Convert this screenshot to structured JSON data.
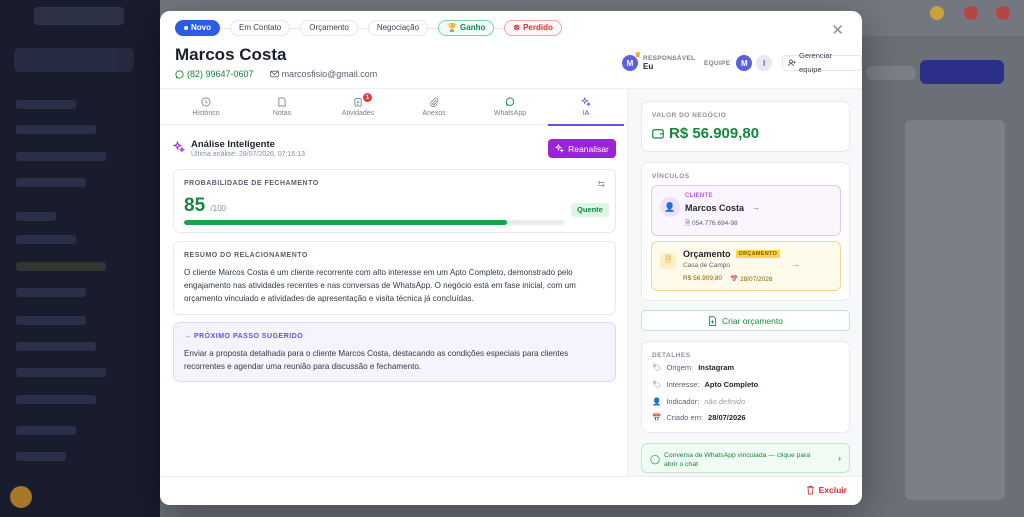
{
  "stages": [
    {
      "label": "Novo",
      "state": "active"
    },
    {
      "label": "Em Contato",
      "state": "default"
    },
    {
      "label": "Orçamento",
      "state": "default"
    },
    {
      "label": "Negociação",
      "state": "default"
    },
    {
      "label": "Ganho",
      "state": "won"
    },
    {
      "label": "Perdido",
      "state": "lost"
    }
  ],
  "lead": {
    "name": "Marcos Costa",
    "phone": "(82) 99647-0607",
    "email": "marcosfisio@gmail.com"
  },
  "responsible": {
    "label": "RESPONSÁVEL",
    "value": "Eu",
    "avatar": "M"
  },
  "team": {
    "label": "EQUIPE",
    "members": [
      "M",
      "I"
    ],
    "manage_label": "Gerenciar equipe"
  },
  "tabs": [
    {
      "label": "Histórico",
      "icon": "history-icon"
    },
    {
      "label": "Notas",
      "icon": "note-icon"
    },
    {
      "label": "Atividades",
      "icon": "clipboard-icon",
      "badge": "1"
    },
    {
      "label": "Anexos",
      "icon": "paperclip-icon"
    },
    {
      "label": "WhatsApp",
      "icon": "whatsapp-icon"
    },
    {
      "label": "IA",
      "icon": "sparkles-icon",
      "active": true
    }
  ],
  "ai": {
    "title": "Análise Inteligente",
    "last_analysis": "Última análise: 28/07/2026, 07:16:13",
    "reanalyze_label": "Reanalisar",
    "probability": {
      "label": "PROBABILIDADE DE FECHAMENTO",
      "value": "85",
      "max": "/100",
      "percent": 85,
      "tag": "Quente"
    },
    "summary": {
      "label": "RESUMO DO RELACIONAMENTO",
      "text": "O cliente Marcos Costa é um cliente recorrente com alto interesse em um Apto Completo, demonstrado pelo engajamento nas atividades recentes e nas conversas de WhatsApp. O negócio está em fase inicial, com um orçamento vinculado e atividades de apresentação e visita técnica já concluídas."
    },
    "next_step": {
      "label": "→ PRÓXIMO PASSO SUGERIDO",
      "text": "Enviar a proposta detalhada para o cliente Marcos Costa, destacando as condições especiais para clientes recorrentes e agendar uma reunião para discussão e fechamento."
    }
  },
  "deal_value": {
    "label": "VALOR DO NEGÓCIO",
    "value": "R$ 56.909,80"
  },
  "links": {
    "label": "VÍNCULOS",
    "client": {
      "tag": "CLIENTE",
      "name": "Marcos Costa",
      "doc": "054.776.694-98"
    },
    "budget": {
      "title": "Orçamento",
      "badge": "ORÇAMENTO",
      "subtitle": "Casa de Campo",
      "amount": "R$ 56.909,80",
      "date": "28/07/2026"
    }
  },
  "create_budget_label": "Criar orçamento",
  "details": {
    "label": "DETALHES",
    "origin_label": "Origem:",
    "origin": "Instagram",
    "interest_label": "Interesse:",
    "interest": "Apto Completo",
    "referrer_label": "Indicador:",
    "referrer": "não definido",
    "created_label": "Criado em:",
    "created": "28/07/2026"
  },
  "whatsapp_link": "Conversa de WhatsApp vinculada — clique para abrir o chat",
  "delete_label": "Excluir",
  "colors": {
    "primary": "#2b5ce6",
    "ai": "#9b22d9",
    "success": "#15873e",
    "danger": "#d43232"
  }
}
